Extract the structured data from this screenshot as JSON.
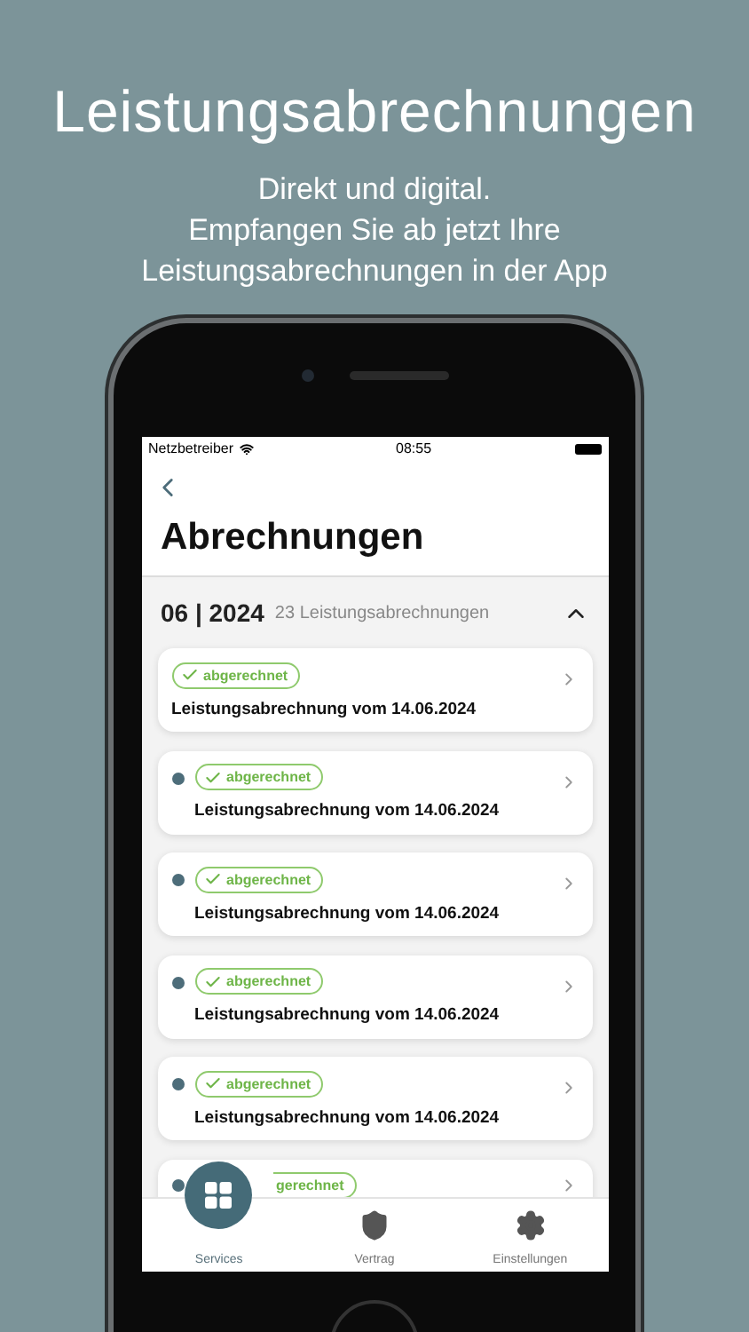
{
  "headline": "Leistungsabrechnungen",
  "subtitle": [
    "Direkt und digital.",
    "Empfangen Sie ab jetzt Ihre",
    "Leistungsabrechnungen in der App"
  ],
  "status_bar": {
    "carrier": "Netzbetreiber",
    "time": "08:55"
  },
  "screen": {
    "title": "Abrechnungen"
  },
  "section": {
    "period": "06 | 2024",
    "count": "23 Leistungsabrechnungen",
    "expanded": true
  },
  "cards": [
    {
      "kind": "full",
      "badge": "abgerechnet",
      "title": "Leistungsabrechnung vom 14.06.2024",
      "unread": false
    },
    {
      "kind": "full",
      "badge": "abgerechnet",
      "title": "Leistungsabrechnung vom 14.06.2024",
      "unread": true
    },
    {
      "kind": "full",
      "badge": "abgerechnet",
      "title": "Leistungsabrechnung vom 14.06.2024",
      "unread": true
    },
    {
      "kind": "full",
      "badge": "abgerechnet",
      "title": "Leistungsabrechnung vom 14.06.2024",
      "unread": true
    },
    {
      "kind": "full",
      "badge": "abgerechnet",
      "title": "Leistungsabrechnung vom 14.06.2024",
      "unread": true
    },
    {
      "kind": "partial",
      "badge": "gerechnet",
      "unread": true
    }
  ],
  "tabs": [
    {
      "label": "Services",
      "selected": true
    },
    {
      "label": "Vertrag",
      "selected": false
    },
    {
      "label": "Einstellungen",
      "selected": false
    }
  ]
}
